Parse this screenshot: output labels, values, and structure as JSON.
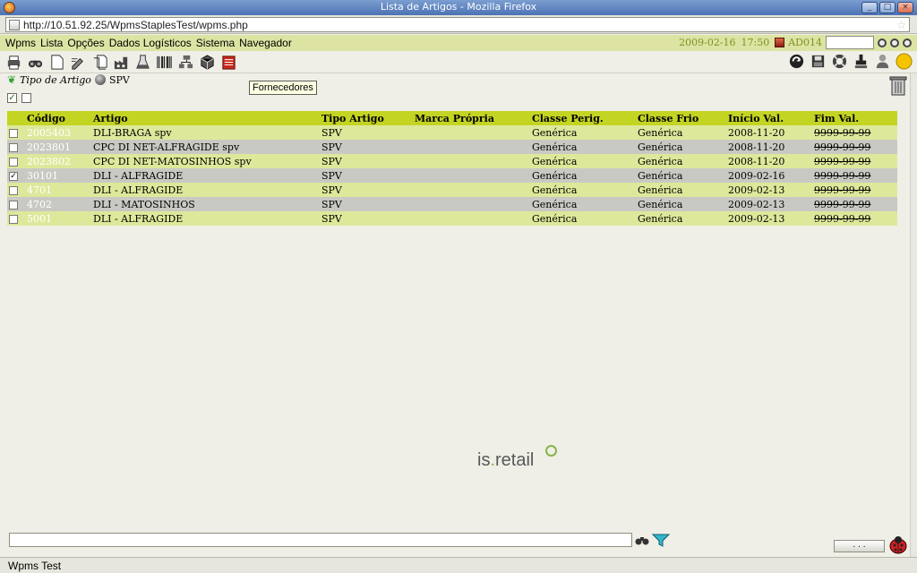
{
  "window": {
    "title": "Lista de Artigos - Mozilla Firefox"
  },
  "browser": {
    "url": "http://10.51.92.25/WpmsStaplesTest/wpms.php"
  },
  "menu": {
    "items": [
      "Wpms",
      "Lista",
      "Opções",
      "Dados Logísticos",
      "Sistema",
      "Navegador"
    ],
    "date": "2009-02-16",
    "time": "17:50",
    "user": "AD014"
  },
  "tooltip": "Fornecedores",
  "filter": {
    "label": "Tipo de Artigo",
    "value": "SPV"
  },
  "table": {
    "headers": [
      "Código",
      "Artigo",
      "Tipo Artigo",
      "Marca Própria",
      "Classe Perig.",
      "Classe Frio",
      "Início Val.",
      "Fim Val."
    ],
    "rows": [
      {
        "checked": false,
        "codigo": "2005403",
        "artigo": "DLI-BRAGA spv",
        "tipo": "SPV",
        "marca": "",
        "perig": "Genérica",
        "frio": "Genérica",
        "inicio": "2008-11-20",
        "fim": "9999-99-99"
      },
      {
        "checked": false,
        "codigo": "2023801",
        "artigo": "CPC DI NET-ALFRAGIDE spv",
        "tipo": "SPV",
        "marca": "",
        "perig": "Genérica",
        "frio": "Genérica",
        "inicio": "2008-11-20",
        "fim": "9999-99-99"
      },
      {
        "checked": false,
        "codigo": "2023802",
        "artigo": "CPC DI NET-MATOSINHOS spv",
        "tipo": "SPV",
        "marca": "",
        "perig": "Genérica",
        "frio": "Genérica",
        "inicio": "2008-11-20",
        "fim": "9999-99-99"
      },
      {
        "checked": true,
        "codigo": "30101",
        "artigo": "DLI - ALFRAGIDE",
        "tipo": "SPV",
        "marca": "",
        "perig": "Genérica",
        "frio": "Genérica",
        "inicio": "2009-02-16",
        "fim": "9999-99-99"
      },
      {
        "checked": false,
        "codigo": "4701",
        "artigo": "DLI - ALFRAGIDE",
        "tipo": "SPV",
        "marca": "",
        "perig": "Genérica",
        "frio": "Genérica",
        "inicio": "2009-02-13",
        "fim": "9999-99-99"
      },
      {
        "checked": false,
        "codigo": "4702",
        "artigo": "DLI - MATOSINHOS",
        "tipo": "SPV",
        "marca": "",
        "perig": "Genérica",
        "frio": "Genérica",
        "inicio": "2009-02-13",
        "fim": "9999-99-99"
      },
      {
        "checked": false,
        "codigo": "5001",
        "artigo": "DLI - ALFRAGIDE",
        "tipo": "SPV",
        "marca": "",
        "perig": "Genérica",
        "frio": "Genérica",
        "inicio": "2009-02-13",
        "fim": "9999-99-99"
      }
    ]
  },
  "logo": {
    "prefix": "is",
    "dot": ".",
    "suffix": "retail"
  },
  "bottom": {
    "dots_label": ". . ."
  },
  "status": "Wpms Test",
  "colors": {
    "header": "#c4d423",
    "row_odd": "#dee89a",
    "row_even": "#c9c9c4",
    "menubar": "#dde4a3",
    "accent": "#7f9226"
  },
  "icons": [
    "printer-icon",
    "binoculars-icon",
    "new-document-icon",
    "edit-icon",
    "copy-document-icon",
    "factory-icon",
    "chemical-icon",
    "barcode-icon",
    "structure-icon",
    "cube-icon",
    "supplier-icon"
  ]
}
